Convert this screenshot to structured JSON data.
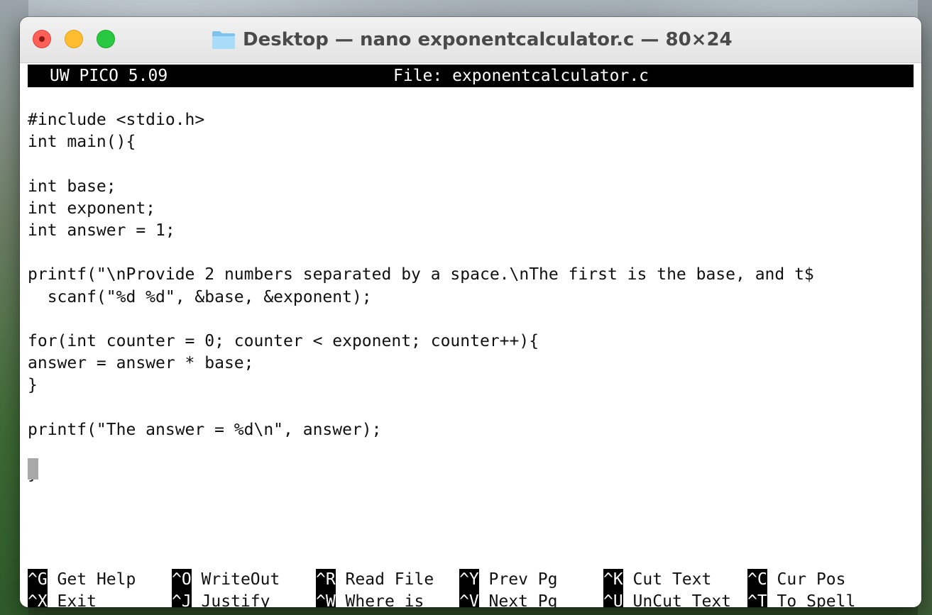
{
  "window": {
    "title": "Desktop — nano exponentcalculator.c — 80×24"
  },
  "editor": {
    "version": "UW PICO 5.09",
    "file_label": "File: exponentcalculator.c",
    "code": "#include <stdio.h>\nint main(){\n\nint base;\nint exponent;\nint answer = 1;\n\nprintf(\"\\nProvide 2 numbers separated by a space.\\nThe first is the base, and t$\n  scanf(\"%d %d\", &base, &exponent);\n\nfor(int counter = 0; counter < exponent; counter++){\nanswer = answer * base;\n}\n\nprintf(\"The answer = %d\\n\", answer);\n\n}"
  },
  "shortcuts": [
    {
      "key": "^G",
      "label": " Get Help"
    },
    {
      "key": "^O",
      "label": " WriteOut"
    },
    {
      "key": "^R",
      "label": " Read File"
    },
    {
      "key": "^Y",
      "label": " Prev Pg"
    },
    {
      "key": "^K",
      "label": " Cut Text"
    },
    {
      "key": "^C",
      "label": " Cur Pos"
    },
    {
      "key": "^X",
      "label": " Exit"
    },
    {
      "key": "^J",
      "label": " Justify"
    },
    {
      "key": "^W",
      "label": " Where is"
    },
    {
      "key": "^V",
      "label": " Next Pg"
    },
    {
      "key": "^U",
      "label": " UnCut Text"
    },
    {
      "key": "^T",
      "label": " To Spell"
    }
  ]
}
